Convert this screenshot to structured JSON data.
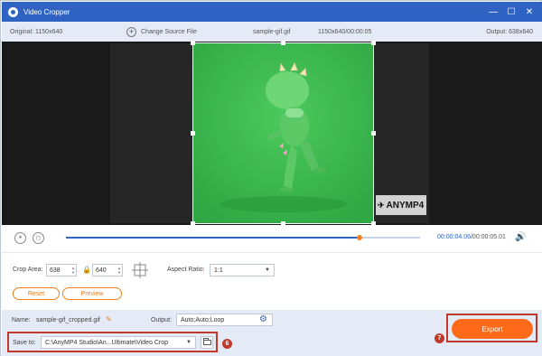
{
  "app": {
    "title": "Video Cropper",
    "window_buttons": {
      "minimize": "—",
      "restore": "☐",
      "close": "✕"
    }
  },
  "infobar": {
    "original": "Original: 1150x640",
    "change_source": "Change Source File",
    "file_name": "sample-gif.gif",
    "dims_time": "1150x640/00:00:05",
    "output": "Output: 638x640"
  },
  "preview": {
    "watermark_text": "ANYMP4",
    "colors": {
      "video": "#35b54a",
      "background": "#1a1a1a"
    }
  },
  "player": {
    "progress": 0.83,
    "current_time": "00:00:04.06",
    "total_time": "/00:00:05.01",
    "play_icon": "⏸",
    "stop_icon": "◻",
    "volume_icon": "🔊"
  },
  "settings": {
    "crop_area_label": "Crop Area:",
    "crop_width": "638",
    "crop_height": "640",
    "aspect_ratio_label": "Aspect Ratio:",
    "aspect_ratio_value": "1:1",
    "reset_label": "Reset",
    "preview_label": "Preview"
  },
  "bottom": {
    "name_label": "Name:",
    "name_value": "sample-gif_cropped.gif",
    "output_label": "Output:",
    "output_value": "Auto;Auto;Loop",
    "save_to_label": "Save to:",
    "save_path": "C:\\AnyMP4 Studio\\An...Ultimate\\Video Crop",
    "export_label": "Export"
  },
  "annotations": {
    "badge_save": "6",
    "badge_export": "7",
    "color": "#c0392b"
  },
  "colors": {
    "accent": "#2f63c3",
    "orange": "#ff6a1a"
  }
}
